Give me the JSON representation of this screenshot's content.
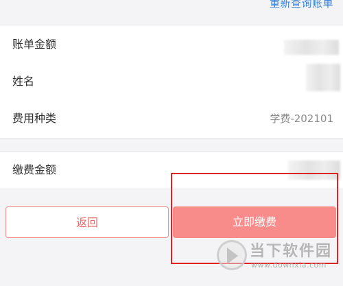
{
  "header": {
    "requery_link": "重新查询账单"
  },
  "bill": {
    "rows": [
      {
        "label": "账单金额",
        "value": ""
      },
      {
        "label": "姓名",
        "value": ""
      },
      {
        "label": "费用种类",
        "value": "学费-202101"
      }
    ]
  },
  "payment": {
    "amount_label": "缴费金额",
    "amount_value": ""
  },
  "actions": {
    "back_label": "返回",
    "pay_label": "立即缴费"
  },
  "watermark": {
    "title": "当下软件园",
    "url": "www.downxia.com"
  },
  "colors": {
    "accent": "#f88c8a",
    "link": "#3b82d6",
    "highlight": "#e02424",
    "background": "#f4f4f6"
  }
}
